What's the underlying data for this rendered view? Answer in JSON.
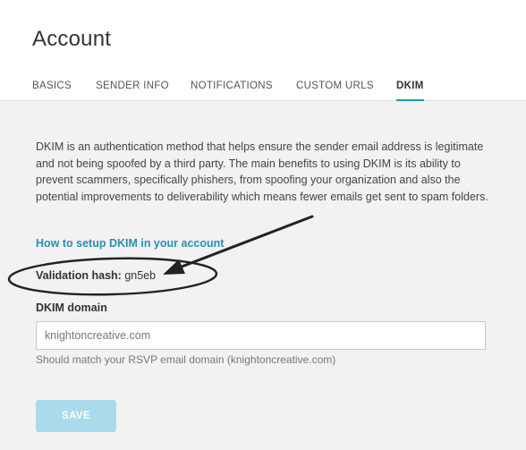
{
  "page": {
    "title": "Account"
  },
  "tabs": [
    {
      "label": "BASICS",
      "active": false
    },
    {
      "label": "SENDER INFO",
      "active": false
    },
    {
      "label": "NOTIFICATIONS",
      "active": false
    },
    {
      "label": "CUSTOM URLS",
      "active": false
    },
    {
      "label": "DKIM",
      "active": true
    }
  ],
  "dkim": {
    "description": "DKIM is an authentication method that helps ensure the sender email address is legitimate and not being spoofed by a third party. The main benefits to using DKIM is its ability to prevent scammers, specifically phishers, from spoofing your organization and also the potential improvements to deliverability which means fewer emails get sent to spam folders.",
    "setup_link": "How to setup DKIM in your account",
    "validation_label": "Validation hash:",
    "validation_value": "gn5eb",
    "domain_label": "DKIM domain",
    "domain_value": "knightoncreative.com",
    "domain_help": "Should match your RSVP email domain (knightoncreative.com)",
    "save_label": "SAVE"
  },
  "colors": {
    "accent": "#2196b6",
    "link": "#2a8fb0",
    "save_button": "#a9dbec",
    "background": "#f2f2f2"
  }
}
